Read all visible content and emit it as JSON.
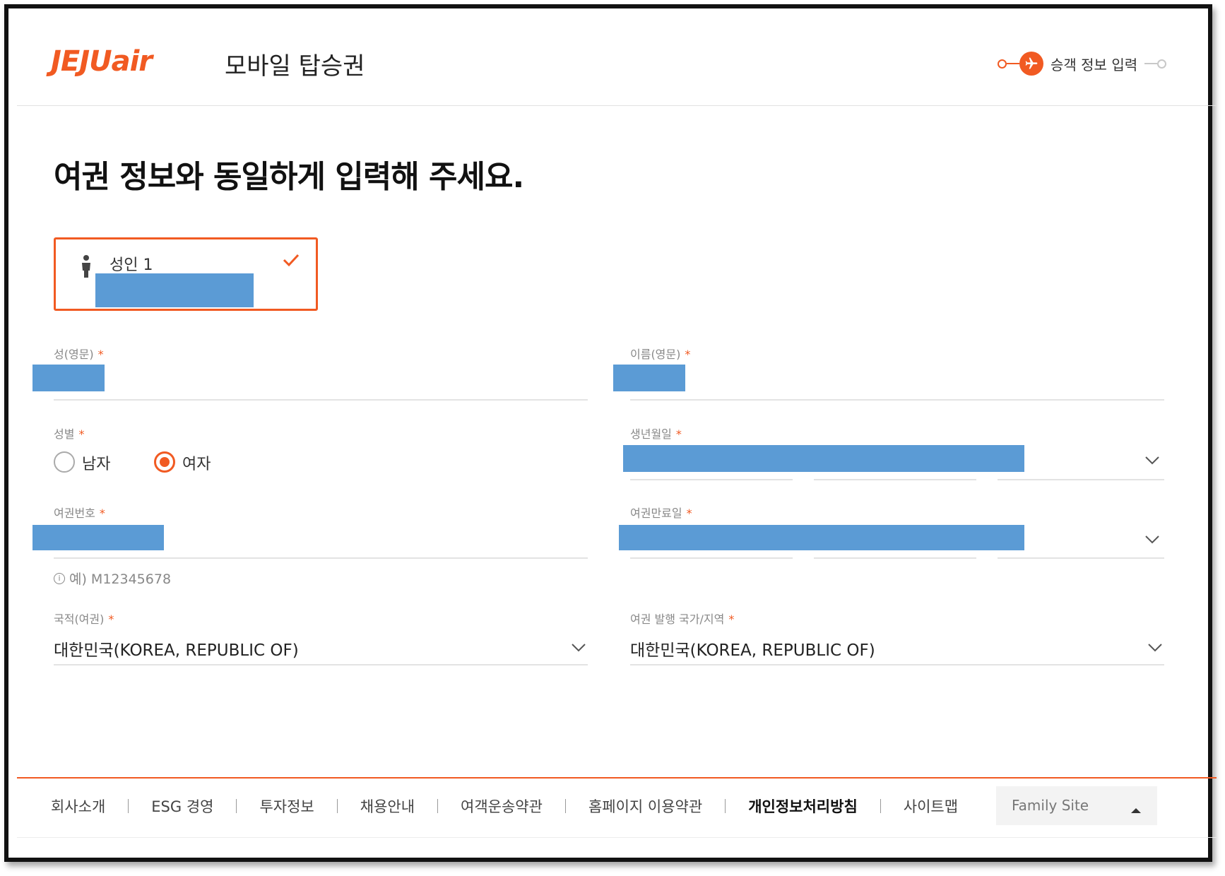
{
  "header": {
    "logo_text": "JEJUair",
    "page_title": "모바일 탑승권",
    "step_label": "승객 정보 입력"
  },
  "main": {
    "heading": "여권 정보와 동일하게 입력해 주세요.",
    "passenger_card": {
      "label": "성인 1",
      "selected": true
    },
    "fields": {
      "last_name": {
        "label": "성(영문)",
        "required_mark": "*"
      },
      "first_name": {
        "label": "이름(영문)",
        "required_mark": "*"
      },
      "gender": {
        "label": "성별",
        "required_mark": "*",
        "options": [
          "남자",
          "여자"
        ],
        "selected": "여자"
      },
      "birth_date": {
        "label": "생년월일",
        "required_mark": "*"
      },
      "passport_number": {
        "label": "여권번호",
        "required_mark": "*",
        "hint": "예) M12345678"
      },
      "passport_expiry": {
        "label": "여권만료일",
        "required_mark": "*"
      },
      "nationality": {
        "label": "국적(여권)",
        "required_mark": "*",
        "value": "대한민국(KOREA, REPUBLIC OF)"
      },
      "issuing_country": {
        "label": "여권 발행 국가/지역",
        "required_mark": "*",
        "value": "대한민국(KOREA, REPUBLIC OF)"
      }
    }
  },
  "footer": {
    "links": [
      "회사소개",
      "ESG 경영",
      "투자정보",
      "채용안내",
      "여객운송약관",
      "홈페이지 이용약관",
      "개인정보처리방침",
      "사이트맵"
    ],
    "family_site_label": "Family Site"
  },
  "colors": {
    "accent": "#f15a22",
    "redaction": "#5b9bd5"
  }
}
